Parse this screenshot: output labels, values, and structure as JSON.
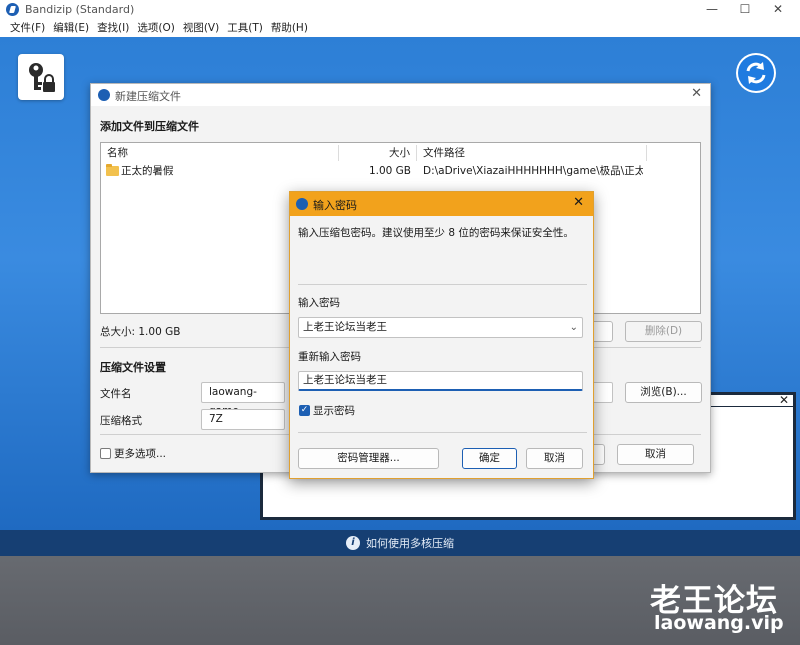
{
  "app": {
    "title": "Bandizip (Standard)",
    "controls": {
      "minimize": "—",
      "maximize": "☐",
      "close": "✕"
    }
  },
  "menu": [
    "文件(F)",
    "编辑(E)",
    "查找(I)",
    "选项(O)",
    "视图(V)",
    "工具(T)",
    "帮助(H)"
  ],
  "bottom_bar": {
    "text": "如何使用多核压缩",
    "icon": "info-icon"
  },
  "new_archive_dialog": {
    "title": "新建压缩文件",
    "close": "✕",
    "add_files_section": "添加文件到压缩文件",
    "columns": {
      "name": "名称",
      "size": "大小",
      "path": "文件路径"
    },
    "files": [
      {
        "name": "正太的暑假",
        "size": "1.00 GB",
        "path": "D:\\aDrive\\XiazaiHHHHHHH\\game\\极品\\正太的..."
      }
    ],
    "total_size": "总大小: 1.00 GB",
    "delete_button": "删除(D)",
    "settings_section": "压缩文件设置",
    "filename_label": "文件名",
    "filename_value": "laowang-game",
    "browse_button": "浏览(B)...",
    "format_label": "压缩格式",
    "format_value": "7Z",
    "more_options": "更多选项...",
    "cancel_button": "取消"
  },
  "password_dialog": {
    "title": "输入密码",
    "close": "✕",
    "description": "输入压缩包密码。建议使用至少 8 位的密码来保证安全性。",
    "password_label": "输入密码",
    "password_value": "上老王论坛当老王",
    "reenter_label": "重新输入密码",
    "reenter_value": "上老王论坛当老王",
    "show_password": "显示密码",
    "show_password_checked": true,
    "manager_button": "密码管理器...",
    "ok_button": "确定",
    "cancel_button": "取消"
  },
  "watermark": {
    "big": "老王论坛",
    "small": "laowang.vip"
  },
  "colors": {
    "workspace": "#2d7fd6",
    "accent": "#1d5fb3",
    "password_title": "#f2a21c",
    "bottom_bar": "#163f73"
  }
}
